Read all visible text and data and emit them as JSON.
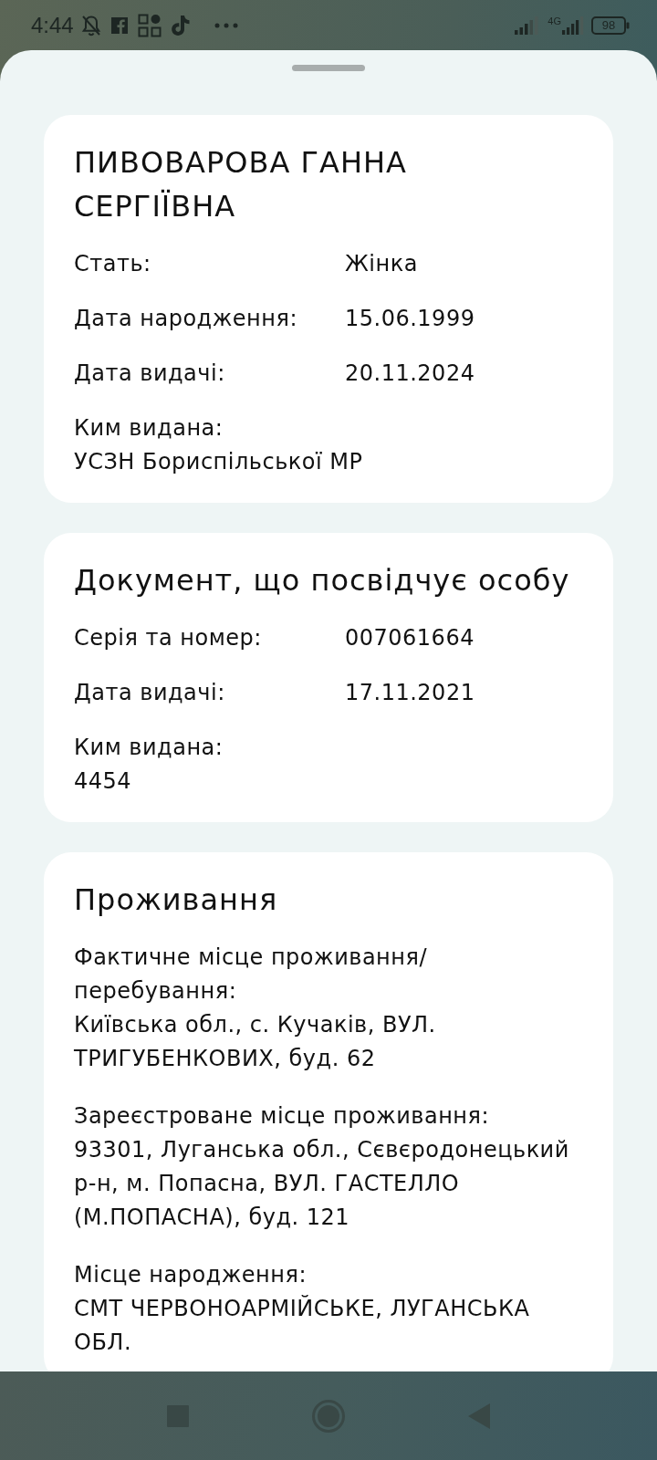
{
  "status_bar": {
    "time": "4:44",
    "network": "4G",
    "battery": "98"
  },
  "cards": [
    {
      "title": "ПИВОВАРОВА ГАННА СЕРГІЇВНА",
      "fields": [
        {
          "kind": "inline",
          "label": "Стать:",
          "value": "Жінка"
        },
        {
          "kind": "inline",
          "label": "Дата народження:",
          "value": "15.06.1999"
        },
        {
          "kind": "inline",
          "label": "Дата видачі:",
          "value": "20.11.2024"
        },
        {
          "kind": "stacked",
          "label": "Ким видана:",
          "value": "УСЗН Бориспільської МР"
        }
      ]
    },
    {
      "title": "Документ, що посвідчує особу",
      "fields": [
        {
          "kind": "inline",
          "label": "Серія та номер:",
          "value": "007061664"
        },
        {
          "kind": "inline",
          "label": "Дата видачі:",
          "value": "17.11.2021"
        },
        {
          "kind": "stacked",
          "label": "Ким видана:",
          "value": "4454"
        }
      ]
    },
    {
      "title": "Проживання",
      "fields": [
        {
          "kind": "block",
          "label": "Фактичне місце проживання/ перебування:",
          "value": "Київська обл., с. Кучаків, ВУЛ. ТРИГУБЕНКОВИХ, буд. 62"
        },
        {
          "kind": "block",
          "label": "Зареєстроване місце проживання:",
          "value": "93301, Луганська обл., Сєвєродонецький р-н, м. Попасна, ВУЛ. ГАСТЕЛЛО (М.ПОПАСНА), буд. 121"
        },
        {
          "kind": "block",
          "label": "Місце народження:",
          "value": "СМТ ЧЕРВОНОАРМІЙСЬКЕ, ЛУГАНСЬКА ОБЛ."
        }
      ]
    }
  ]
}
